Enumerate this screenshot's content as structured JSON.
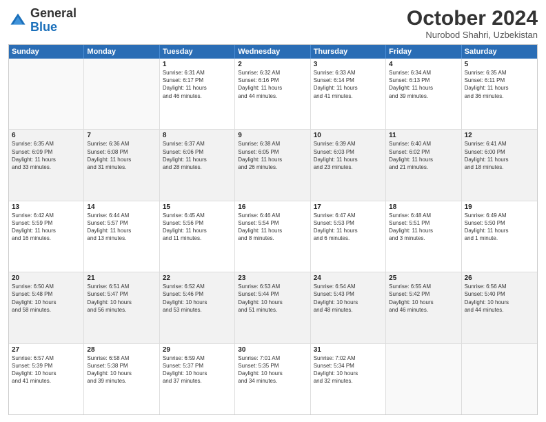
{
  "header": {
    "logo_general": "General",
    "logo_blue": "Blue",
    "month_year": "October 2024",
    "location": "Nurobod Shahri, Uzbekistan"
  },
  "calendar": {
    "days_of_week": [
      "Sunday",
      "Monday",
      "Tuesday",
      "Wednesday",
      "Thursday",
      "Friday",
      "Saturday"
    ],
    "rows": [
      [
        {
          "day": "",
          "lines": [],
          "empty": true
        },
        {
          "day": "",
          "lines": [],
          "empty": true
        },
        {
          "day": "1",
          "lines": [
            "Sunrise: 6:31 AM",
            "Sunset: 6:17 PM",
            "Daylight: 11 hours",
            "and 46 minutes."
          ],
          "empty": false
        },
        {
          "day": "2",
          "lines": [
            "Sunrise: 6:32 AM",
            "Sunset: 6:16 PM",
            "Daylight: 11 hours",
            "and 44 minutes."
          ],
          "empty": false
        },
        {
          "day": "3",
          "lines": [
            "Sunrise: 6:33 AM",
            "Sunset: 6:14 PM",
            "Daylight: 11 hours",
            "and 41 minutes."
          ],
          "empty": false
        },
        {
          "day": "4",
          "lines": [
            "Sunrise: 6:34 AM",
            "Sunset: 6:13 PM",
            "Daylight: 11 hours",
            "and 39 minutes."
          ],
          "empty": false
        },
        {
          "day": "5",
          "lines": [
            "Sunrise: 6:35 AM",
            "Sunset: 6:11 PM",
            "Daylight: 11 hours",
            "and 36 minutes."
          ],
          "empty": false
        }
      ],
      [
        {
          "day": "6",
          "lines": [
            "Sunrise: 6:35 AM",
            "Sunset: 6:09 PM",
            "Daylight: 11 hours",
            "and 33 minutes."
          ],
          "empty": false
        },
        {
          "day": "7",
          "lines": [
            "Sunrise: 6:36 AM",
            "Sunset: 6:08 PM",
            "Daylight: 11 hours",
            "and 31 minutes."
          ],
          "empty": false
        },
        {
          "day": "8",
          "lines": [
            "Sunrise: 6:37 AM",
            "Sunset: 6:06 PM",
            "Daylight: 11 hours",
            "and 28 minutes."
          ],
          "empty": false
        },
        {
          "day": "9",
          "lines": [
            "Sunrise: 6:38 AM",
            "Sunset: 6:05 PM",
            "Daylight: 11 hours",
            "and 26 minutes."
          ],
          "empty": false
        },
        {
          "day": "10",
          "lines": [
            "Sunrise: 6:39 AM",
            "Sunset: 6:03 PM",
            "Daylight: 11 hours",
            "and 23 minutes."
          ],
          "empty": false
        },
        {
          "day": "11",
          "lines": [
            "Sunrise: 6:40 AM",
            "Sunset: 6:02 PM",
            "Daylight: 11 hours",
            "and 21 minutes."
          ],
          "empty": false
        },
        {
          "day": "12",
          "lines": [
            "Sunrise: 6:41 AM",
            "Sunset: 6:00 PM",
            "Daylight: 11 hours",
            "and 18 minutes."
          ],
          "empty": false
        }
      ],
      [
        {
          "day": "13",
          "lines": [
            "Sunrise: 6:42 AM",
            "Sunset: 5:59 PM",
            "Daylight: 11 hours",
            "and 16 minutes."
          ],
          "empty": false
        },
        {
          "day": "14",
          "lines": [
            "Sunrise: 6:44 AM",
            "Sunset: 5:57 PM",
            "Daylight: 11 hours",
            "and 13 minutes."
          ],
          "empty": false
        },
        {
          "day": "15",
          "lines": [
            "Sunrise: 6:45 AM",
            "Sunset: 5:56 PM",
            "Daylight: 11 hours",
            "and 11 minutes."
          ],
          "empty": false
        },
        {
          "day": "16",
          "lines": [
            "Sunrise: 6:46 AM",
            "Sunset: 5:54 PM",
            "Daylight: 11 hours",
            "and 8 minutes."
          ],
          "empty": false
        },
        {
          "day": "17",
          "lines": [
            "Sunrise: 6:47 AM",
            "Sunset: 5:53 PM",
            "Daylight: 11 hours",
            "and 6 minutes."
          ],
          "empty": false
        },
        {
          "day": "18",
          "lines": [
            "Sunrise: 6:48 AM",
            "Sunset: 5:51 PM",
            "Daylight: 11 hours",
            "and 3 minutes."
          ],
          "empty": false
        },
        {
          "day": "19",
          "lines": [
            "Sunrise: 6:49 AM",
            "Sunset: 5:50 PM",
            "Daylight: 11 hours",
            "and 1 minute."
          ],
          "empty": false
        }
      ],
      [
        {
          "day": "20",
          "lines": [
            "Sunrise: 6:50 AM",
            "Sunset: 5:48 PM",
            "Daylight: 10 hours",
            "and 58 minutes."
          ],
          "empty": false
        },
        {
          "day": "21",
          "lines": [
            "Sunrise: 6:51 AM",
            "Sunset: 5:47 PM",
            "Daylight: 10 hours",
            "and 56 minutes."
          ],
          "empty": false
        },
        {
          "day": "22",
          "lines": [
            "Sunrise: 6:52 AM",
            "Sunset: 5:46 PM",
            "Daylight: 10 hours",
            "and 53 minutes."
          ],
          "empty": false
        },
        {
          "day": "23",
          "lines": [
            "Sunrise: 6:53 AM",
            "Sunset: 5:44 PM",
            "Daylight: 10 hours",
            "and 51 minutes."
          ],
          "empty": false
        },
        {
          "day": "24",
          "lines": [
            "Sunrise: 6:54 AM",
            "Sunset: 5:43 PM",
            "Daylight: 10 hours",
            "and 48 minutes."
          ],
          "empty": false
        },
        {
          "day": "25",
          "lines": [
            "Sunrise: 6:55 AM",
            "Sunset: 5:42 PM",
            "Daylight: 10 hours",
            "and 46 minutes."
          ],
          "empty": false
        },
        {
          "day": "26",
          "lines": [
            "Sunrise: 6:56 AM",
            "Sunset: 5:40 PM",
            "Daylight: 10 hours",
            "and 44 minutes."
          ],
          "empty": false
        }
      ],
      [
        {
          "day": "27",
          "lines": [
            "Sunrise: 6:57 AM",
            "Sunset: 5:39 PM",
            "Daylight: 10 hours",
            "and 41 minutes."
          ],
          "empty": false
        },
        {
          "day": "28",
          "lines": [
            "Sunrise: 6:58 AM",
            "Sunset: 5:38 PM",
            "Daylight: 10 hours",
            "and 39 minutes."
          ],
          "empty": false
        },
        {
          "day": "29",
          "lines": [
            "Sunrise: 6:59 AM",
            "Sunset: 5:37 PM",
            "Daylight: 10 hours",
            "and 37 minutes."
          ],
          "empty": false
        },
        {
          "day": "30",
          "lines": [
            "Sunrise: 7:01 AM",
            "Sunset: 5:35 PM",
            "Daylight: 10 hours",
            "and 34 minutes."
          ],
          "empty": false
        },
        {
          "day": "31",
          "lines": [
            "Sunrise: 7:02 AM",
            "Sunset: 5:34 PM",
            "Daylight: 10 hours",
            "and 32 minutes."
          ],
          "empty": false
        },
        {
          "day": "",
          "lines": [],
          "empty": true
        },
        {
          "day": "",
          "lines": [],
          "empty": true
        }
      ]
    ]
  }
}
